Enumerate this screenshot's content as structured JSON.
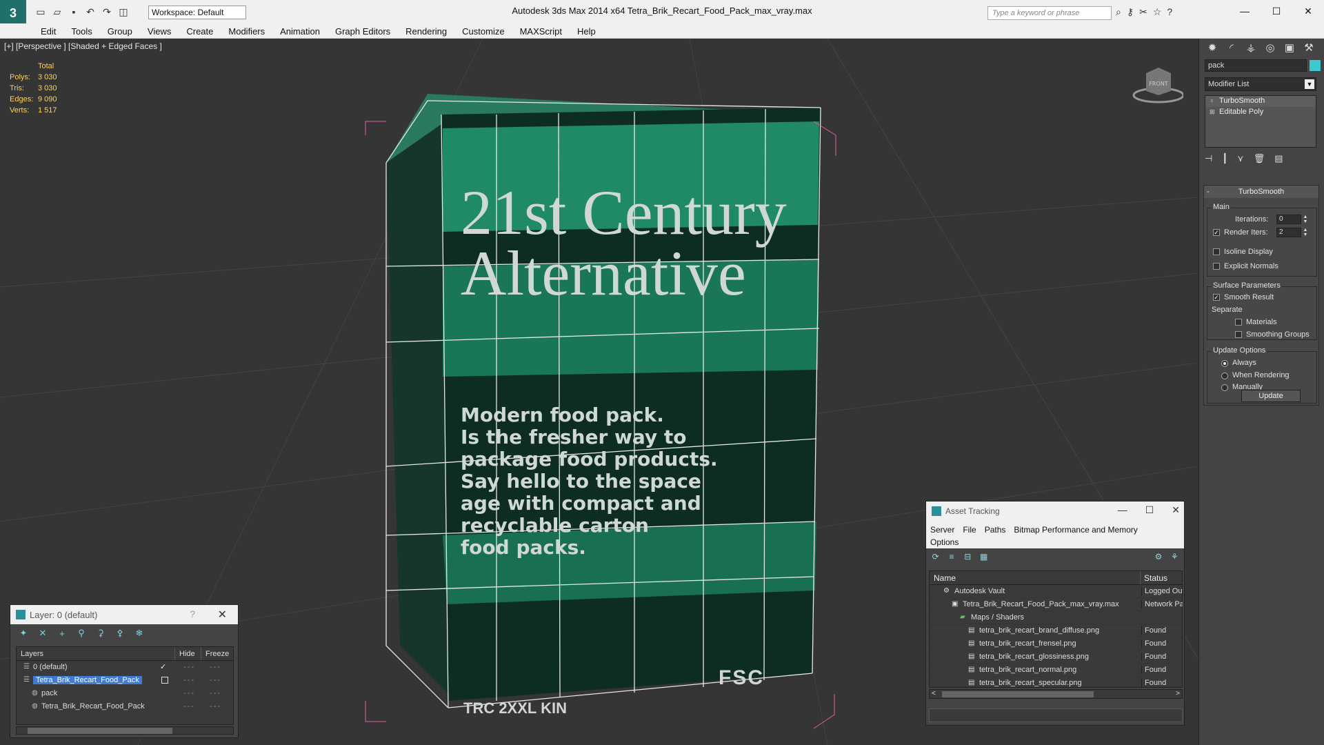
{
  "app": {
    "title": "Autodesk 3ds Max  2014 x64     Tetra_Brik_Recart_Food_Pack_max_vray.max",
    "workspace": "Workspace: Default",
    "search_placeholder": "Type a keyword or phrase"
  },
  "menu": [
    "Edit",
    "Tools",
    "Group",
    "Views",
    "Create",
    "Modifiers",
    "Animation",
    "Graph Editors",
    "Rendering",
    "Customize",
    "MAXScript",
    "Help"
  ],
  "viewport": {
    "label": "[+] [Perspective ] [Shaded + Edged Faces ]",
    "stats_header": "Total",
    "stats": [
      {
        "label": "Polys:",
        "value": "3 030"
      },
      {
        "label": "Tris:",
        "value": "3 030"
      },
      {
        "label": "Edges:",
        "value": "9 090"
      },
      {
        "label": "Verts:",
        "value": "1 517"
      }
    ],
    "pack_heading": [
      "21st Century",
      "Alternative"
    ],
    "pack_body": [
      "Modern food pack.",
      "Is the fresher way to",
      "package food products.",
      "Say hello to the space",
      "age with compact and",
      "recyclable carton",
      "food packs."
    ],
    "pack_logo": "FSC",
    "pack_code": "TRC 2XXL KIN",
    "viewcube_label": "FRONT"
  },
  "command_panel": {
    "object_name": "pack",
    "object_color": "#3ec9d0",
    "modifier_list": "Modifier List",
    "stack": [
      {
        "label": "TurboSmooth",
        "icon": "lightbulb-icon"
      },
      {
        "label": "Editable Poly",
        "icon": "plus-box-icon"
      }
    ],
    "rollout_title": "TurboSmooth",
    "main_label": "Main",
    "iterations_label": "Iterations:",
    "iterations_value": "0",
    "render_iters_label": "Render Iters:",
    "render_iters_value": "2",
    "isoline_label": "Isoline Display",
    "explicit_normals_label": "Explicit Normals",
    "surface_params_label": "Surface Parameters",
    "smooth_result_label": "Smooth Result",
    "separate_label": "Separate",
    "materials_label": "Materials",
    "smoothing_groups_label": "Smoothing Groups",
    "update_options_label": "Update Options",
    "always_label": "Always",
    "when_rendering_label": "When Rendering",
    "manually_label": "Manually",
    "update_button": "Update"
  },
  "layer_window": {
    "title": "Layer: 0 (default)",
    "question": "?",
    "columns": {
      "layers": "Layers",
      "hide": "Hide",
      "freeze": "Freeze"
    },
    "rows": [
      {
        "name": "0 (default)",
        "indent": 0
      },
      {
        "name": "Tetra_Brik_Recart_Food_Pack",
        "indent": 0
      },
      {
        "name": "pack",
        "indent": 1
      },
      {
        "name": "Tetra_Brik_Recart_Food_Pack",
        "indent": 1
      }
    ]
  },
  "asset_window": {
    "title": "Asset Tracking",
    "menu": [
      "Server",
      "File",
      "Paths",
      "Bitmap Performance and Memory",
      "Options"
    ],
    "columns": {
      "name": "Name",
      "status": "Status"
    },
    "rows": [
      {
        "name": "Autodesk Vault",
        "status": "Logged Out",
        "indent": 1
      },
      {
        "name": "Tetra_Brik_Recart_Food_Pack_max_vray.max",
        "status": "Network Path",
        "indent": 2
      },
      {
        "name": "Maps / Shaders",
        "status": "",
        "indent": 3
      },
      {
        "name": "tetra_brik_recart_brand_diffuse.png",
        "status": "Found",
        "indent": 4
      },
      {
        "name": "tetra_brik_recart_frensel.png",
        "status": "Found",
        "indent": 4
      },
      {
        "name": "tetra_brik_recart_glossiness.png",
        "status": "Found",
        "indent": 4
      },
      {
        "name": "tetra_brik_recart_normal.png",
        "status": "Found",
        "indent": 4
      },
      {
        "name": "tetra_brik_recart_specular.png",
        "status": "Found",
        "indent": 4
      }
    ]
  }
}
